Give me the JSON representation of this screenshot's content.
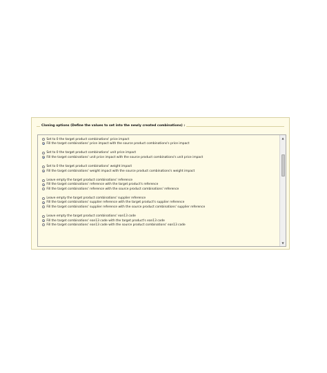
{
  "panel": {
    "legend": "Cloning options (Define the values to set into the newly created combinations) :"
  },
  "groups": [
    {
      "options": [
        {
          "label": "Set to 0 the target product combinations' price impact",
          "selected": false
        },
        {
          "label": "Fill the target combinations' price impact with the source product combinations's price impact",
          "selected": true
        }
      ]
    },
    {
      "options": [
        {
          "label": "Set to 0 the target product combinations' unit price impact",
          "selected": false
        },
        {
          "label": "Fill the target combinations' unit price impact with the source product combinations's unit price impact",
          "selected": true
        }
      ]
    },
    {
      "options": [
        {
          "label": "Set to 0 the target product combinations' weight impact",
          "selected": false
        },
        {
          "label": "Fill the target combinations' weight impact with the source product combinations's weight impact",
          "selected": true
        }
      ]
    },
    {
      "options": [
        {
          "label": "Leave empty the target product combinations' reference",
          "selected": false
        },
        {
          "label": "Fill the target combinations' reference with the target product's reference",
          "selected": true
        },
        {
          "label": "Fill the target combinations' reference with the source product combinations' reference",
          "selected": false
        }
      ]
    },
    {
      "options": [
        {
          "label": "Leave empty the target product combinations' supplier reference",
          "selected": false
        },
        {
          "label": "Fill the target combinations' supplier reference with the target product's supplier reference",
          "selected": true
        },
        {
          "label": "Fill the target combinations' supplier reference with the source product combinations' supplier reference",
          "selected": false
        }
      ]
    },
    {
      "options": [
        {
          "label": "Leave empty the target product combinations' ean13 code",
          "selected": false
        },
        {
          "label": "Fill the target combinations' ean13 code with the target product's ean13 code",
          "selected": true
        },
        {
          "label": "Fill the target combinations' ean13 code with the source product combinations' ean13 code",
          "selected": false
        }
      ]
    }
  ],
  "scrollbar": {
    "up_arrow": "▲",
    "down_arrow": "▼"
  }
}
